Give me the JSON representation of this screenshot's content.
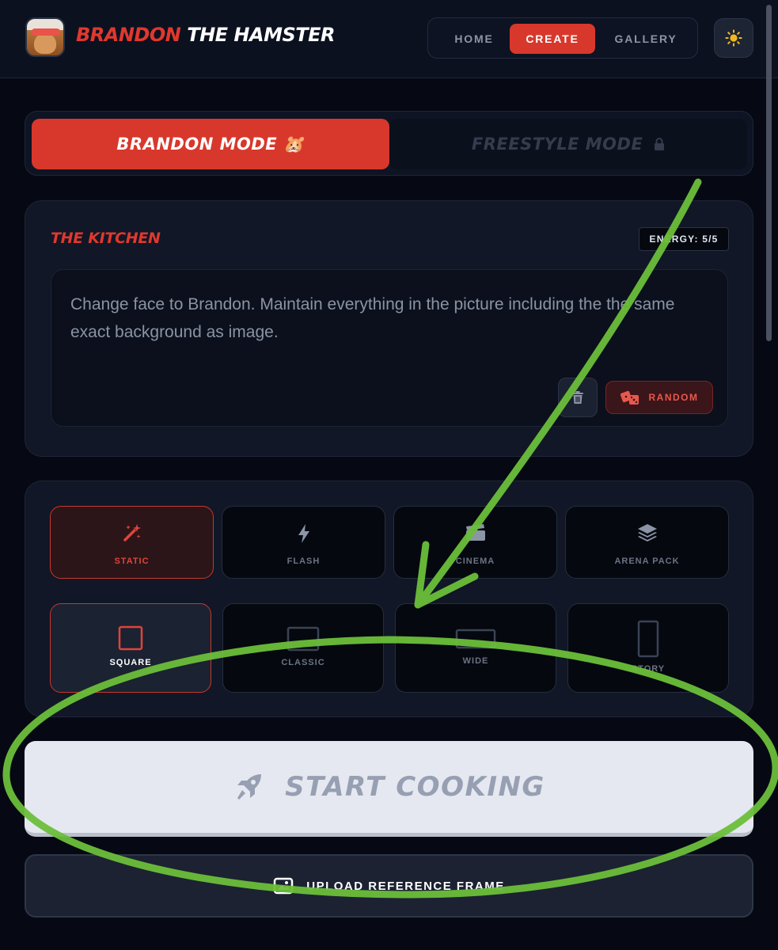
{
  "header": {
    "brand_part1": "BRANDON",
    "brand_part2": "THE HAMSTER",
    "logo_icon": "hamster-avatar-icon",
    "nav": {
      "home": "HOME",
      "create": "CREATE",
      "gallery": "GALLERY",
      "active": "CREATE"
    },
    "theme_icon": "sun-icon"
  },
  "mode": {
    "brandon_label": "BRANDON MODE 🐹",
    "freestyle_label": "FREESTYLE MODE",
    "freestyle_icon": "lock-icon",
    "active": "BRANDON MODE"
  },
  "kitchen": {
    "title": "THE KITCHEN",
    "energy": "ENERGY: 5/5",
    "prompt": "Change face to Brandon. Maintain everything in the picture including the the same  exact background as image.",
    "random_label": "RANDOM",
    "random_icon": "dice-icon",
    "trash_icon": "trash-icon"
  },
  "modes_row": [
    {
      "label": "STATIC",
      "icon": "magic-wand-icon",
      "selected": true
    },
    {
      "label": "FLASH",
      "icon": "bolt-icon",
      "selected": false
    },
    {
      "label": "CINEMA",
      "icon": "clapperboard-icon",
      "selected": false
    },
    {
      "label": "ARENA PACK",
      "icon": "layers-icon",
      "selected": false
    }
  ],
  "aspect_row": [
    {
      "label": "SQUARE",
      "icon": "square-icon",
      "selected": true
    },
    {
      "label": "CLASSIC",
      "icon": "classic-rect-icon",
      "selected": false
    },
    {
      "label": "WIDE",
      "icon": "wide-rect-icon",
      "selected": false
    },
    {
      "label": "STORY",
      "icon": "portrait-rect-icon",
      "selected": false
    }
  ],
  "start": {
    "label": "START COOKING",
    "icon": "rocket-icon"
  },
  "upload": {
    "label": "UPLOAD REFERENCE FRAME",
    "icon": "image-upload-icon"
  },
  "colors": {
    "accent": "#d8382c",
    "background": "#060913",
    "card": "#111726",
    "annotation": "#6bbf3a"
  }
}
